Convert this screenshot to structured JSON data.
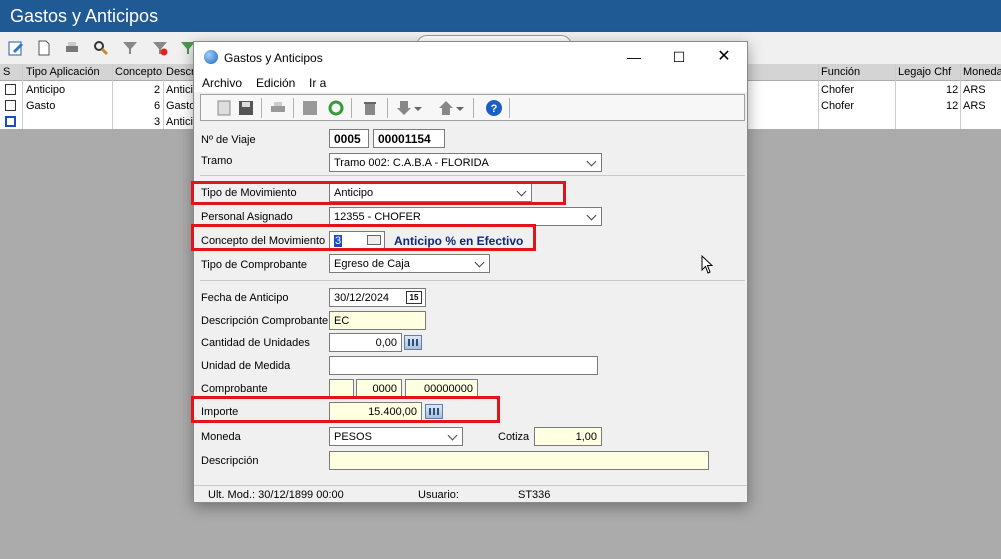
{
  "app": {
    "title": "Gastos y Anticipos"
  },
  "grid": {
    "columns": [
      "S",
      "Tipo Aplicación",
      "Concepto",
      "Descr",
      "Función",
      "Legajo Chf",
      "Moneda"
    ],
    "rows": [
      {
        "tipo": "Anticipo",
        "concepto": "2",
        "desc": "Anticip",
        "funcion": "Chofer",
        "legajo": "12",
        "moneda": "ARS"
      },
      {
        "tipo": "Gasto",
        "concepto": "6",
        "desc": "Gasto",
        "funcion": "Chofer",
        "legajo": "12",
        "moneda": "ARS"
      },
      {
        "tipo": "",
        "concepto": "3",
        "desc": "Anticip",
        "funcion": "",
        "legajo": "",
        "moneda": ""
      }
    ]
  },
  "dialog": {
    "title": "Gastos y Anticipos",
    "menu": [
      "Archivo",
      "Edición",
      "Ir a"
    ],
    "labels": {
      "viaje": "Nº de Viaje",
      "tramo": "Tramo",
      "tipo_mov": "Tipo de Movimiento",
      "personal": "Personal Asignado",
      "concepto": "Concepto del Movimiento",
      "tipo_comp": "Tipo de Comprobante",
      "fecha": "Fecha de Anticipo",
      "desc_comp": "Descripción Comprobante",
      "cantidad": "Cantidad de Unidades",
      "unidad": "Unidad de Medida",
      "comprobante": "Comprobante",
      "importe": "Importe",
      "moneda": "Moneda",
      "cotiza": "Cotiza",
      "descripcion": "Descripción"
    },
    "values": {
      "viaje_a": "0005",
      "viaje_b": "00001154",
      "tramo": "Tramo 002:  C.A.B.A - FLORIDA",
      "tipo_mov": "Anticipo",
      "personal": "12355 - CHOFER",
      "concepto": "3",
      "concepto_desc": "Anticipo % en Efectivo",
      "tipo_comp": "Egreso de Caja",
      "fecha": "30/12/2024",
      "fecha_icon": "15",
      "desc_comp": "EC",
      "cantidad": "0,00",
      "unidad": "",
      "comp_a": "",
      "comp_b": "0000",
      "comp_c": "00000000",
      "importe": "15.400,00",
      "moneda": "PESOS",
      "cotiza": "1,00",
      "descripcion": ""
    },
    "status": {
      "ult_mod": "Ult. Mod.: 30/12/1899 00:00",
      "usuario_label": "Usuario:",
      "usuario": "ST336"
    }
  }
}
